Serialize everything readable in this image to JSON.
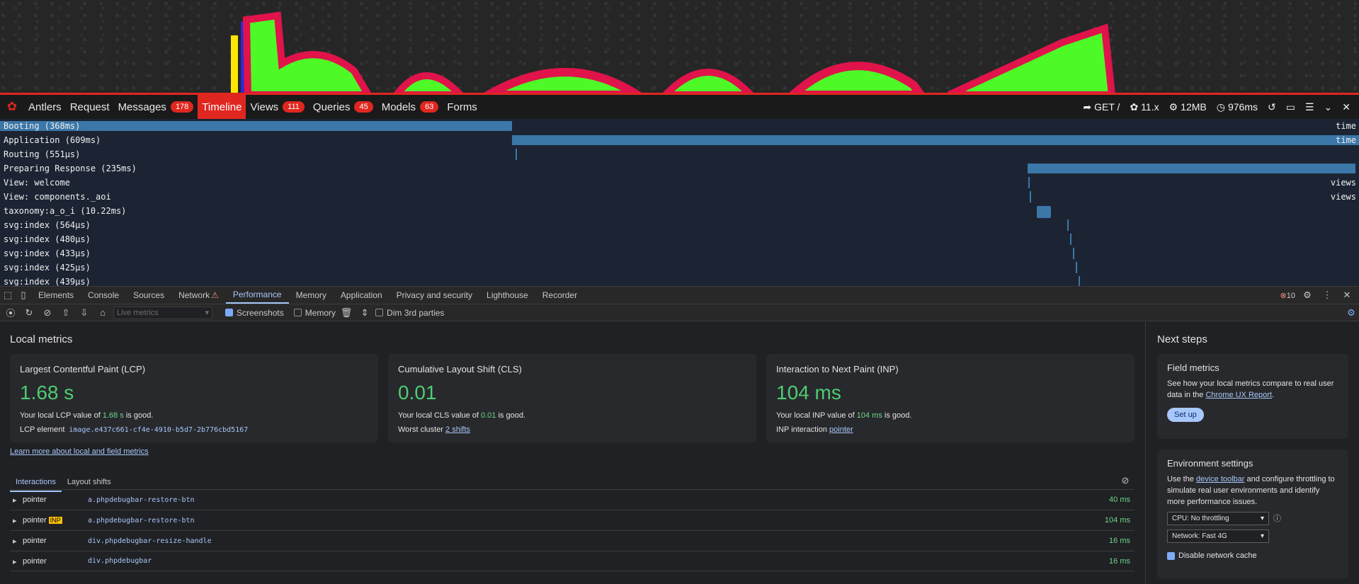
{
  "debugbar": {
    "tabs": [
      {
        "label": "Antlers"
      },
      {
        "label": "Request"
      },
      {
        "label": "Messages",
        "badge": "178"
      },
      {
        "label": "Timeline"
      },
      {
        "label": "Views",
        "badge": "111"
      },
      {
        "label": "Queries",
        "badge": "45"
      },
      {
        "label": "Models",
        "badge": "63"
      },
      {
        "label": "Forms"
      }
    ],
    "route": "GET /",
    "version": "11.x",
    "memory": "12MB",
    "duration": "976ms"
  },
  "timeline": {
    "rows": [
      {
        "label": "Booting (368ms)",
        "col": "time"
      },
      {
        "label": "Application (609ms)",
        "col": "time"
      },
      {
        "label": "Routing (551μs)",
        "col": ""
      },
      {
        "label": "Preparing Response (235ms)",
        "col": ""
      },
      {
        "label": "View: welcome",
        "col": "views"
      },
      {
        "label": "View: components._aoi",
        "col": "views"
      },
      {
        "label": "taxonomy:a_o_i (10.22ms)",
        "col": ""
      },
      {
        "label": "svg:index (564μs)",
        "col": ""
      },
      {
        "label": "svg:index (480μs)",
        "col": ""
      },
      {
        "label": "svg:index (433μs)",
        "col": ""
      },
      {
        "label": "svg:index (425μs)",
        "col": ""
      },
      {
        "label": "svg:index (439μs)",
        "col": ""
      }
    ]
  },
  "devtools": {
    "tabs": [
      "Elements",
      "Console",
      "Sources",
      "Network",
      "Performance",
      "Memory",
      "Application",
      "Privacy and security",
      "Lighthouse",
      "Recorder"
    ],
    "error_count": "10",
    "toolbar": {
      "select": "Live metrics",
      "screenshots": "Screenshots",
      "memory": "Memory",
      "dim": "Dim 3rd parties"
    }
  },
  "local": {
    "title": "Local metrics",
    "cards": [
      {
        "title": "Largest Contentful Paint (LCP)",
        "value": "1.68 s",
        "pre": "Your local LCP value of ",
        "hl": "1.68 s",
        "post": " is good.",
        "elabel": "LCP element",
        "evalue": "image.e437c661-cf4e-4910-b5d7-2b776cbd5167"
      },
      {
        "title": "Cumulative Layout Shift (CLS)",
        "value": "0.01",
        "pre": "Your local CLS value of ",
        "hl": "0.01",
        "post": " is good.",
        "elabel": "Worst cluster",
        "evalue": "2 shifts"
      },
      {
        "title": "Interaction to Next Paint (INP)",
        "value": "104 ms",
        "pre": "Your local INP value of ",
        "hl": "104 ms",
        "post": " is good.",
        "elabel": "INP interaction",
        "evalue": "pointer"
      }
    ],
    "learn": "Learn more about local and field metrics",
    "itabs": [
      "Interactions",
      "Layout shifts"
    ],
    "interactions": [
      {
        "type": "pointer",
        "tag": "",
        "sel": "a.phpdebugbar-restore-btn",
        "ms": "40 ms"
      },
      {
        "type": "pointer",
        "tag": "INP",
        "sel": "a.phpdebugbar-restore-btn",
        "ms": "104 ms"
      },
      {
        "type": "pointer",
        "tag": "",
        "sel": "div.phpdebugbar-resize-handle",
        "ms": "16 ms"
      },
      {
        "type": "pointer",
        "tag": "",
        "sel": "div.phpdebugbar",
        "ms": "16 ms"
      }
    ]
  },
  "next": {
    "title": "Next steps",
    "field_title": "Field metrics",
    "field_pre": "See how your local metrics compare to real user data in the ",
    "field_link": "Chrome UX Report",
    "field_post": ".",
    "setup": "Set up",
    "env_title": "Environment settings",
    "env_pre": "Use the ",
    "env_link": "device toolbar",
    "env_post": " and configure throttling to simulate real user environments and identify more performance issues.",
    "cpu": "CPU: No throttling",
    "net": "Network: Fast 4G",
    "cache": "Disable network cache"
  }
}
